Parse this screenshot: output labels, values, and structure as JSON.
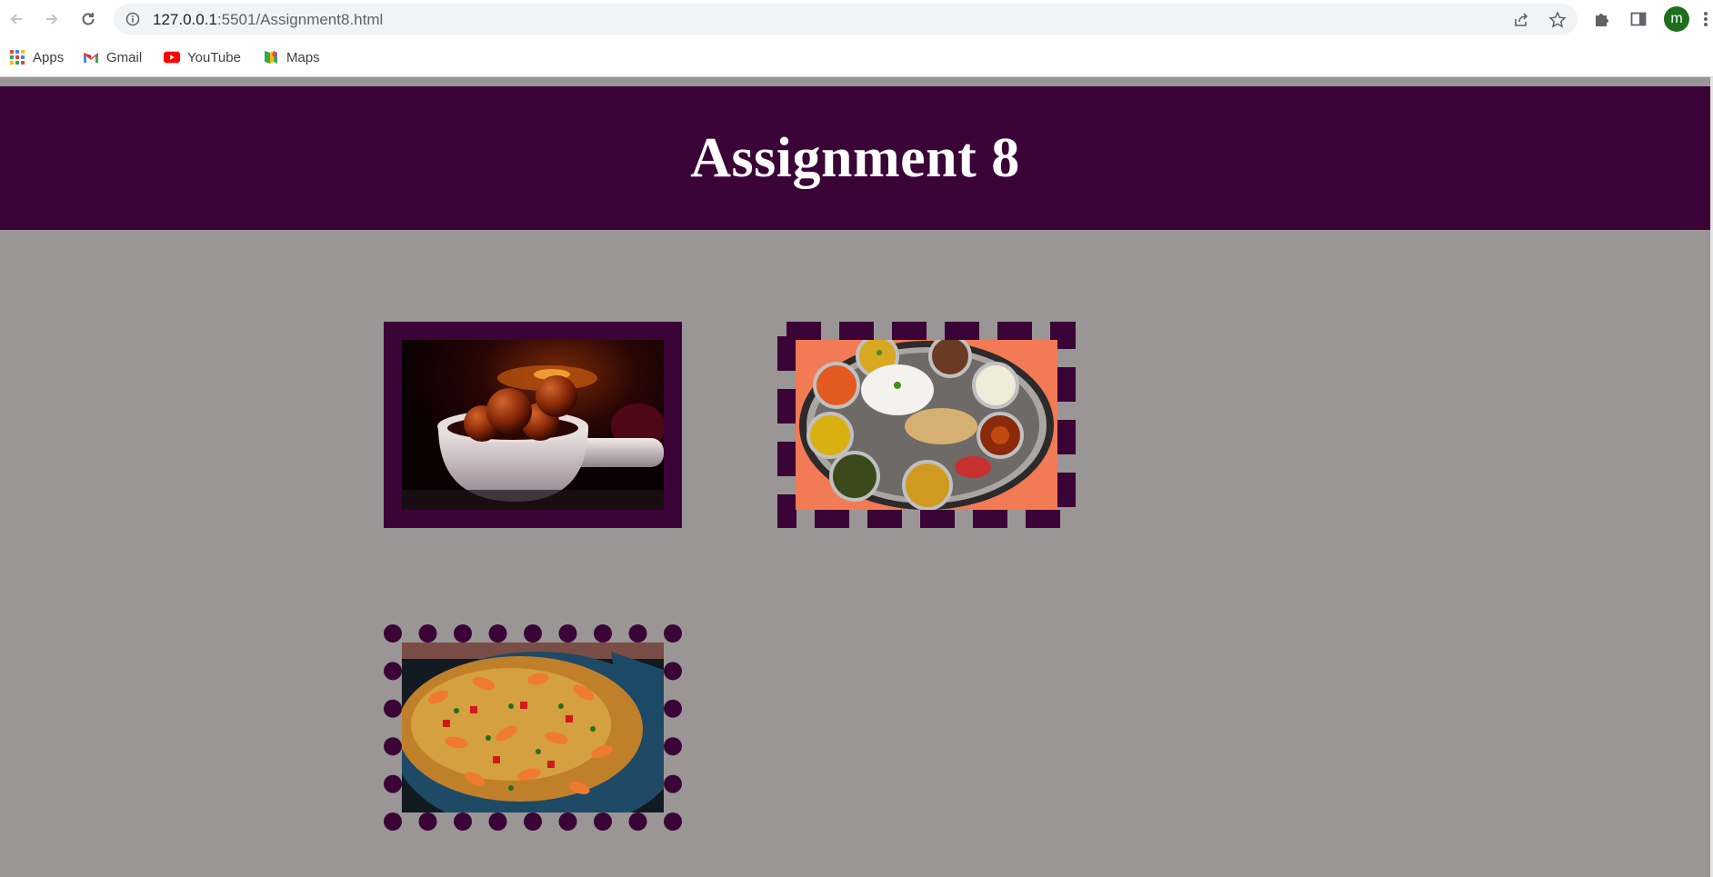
{
  "browser": {
    "url_host": "127.0.0.1",
    "url_path": ":5501/Assignment8.html",
    "profile_initial": "m",
    "bookmarks": [
      {
        "label": "Apps",
        "icon": "apps-grid-icon"
      },
      {
        "label": "Gmail",
        "icon": "gmail-icon"
      },
      {
        "label": "YouTube",
        "icon": "youtube-icon"
      },
      {
        "label": "Maps",
        "icon": "maps-icon"
      }
    ]
  },
  "page": {
    "title": "Assignment 8",
    "colors": {
      "header_bg": "#3a0536",
      "page_bg": "#9b9696",
      "border": "#3a0536"
    },
    "images": [
      {
        "name": "gulab-jamun-photo",
        "border_style": "solid"
      },
      {
        "name": "thali-photo",
        "border_style": "dashed"
      },
      {
        "name": "biryani-photo",
        "border_style": "dotted"
      }
    ]
  }
}
